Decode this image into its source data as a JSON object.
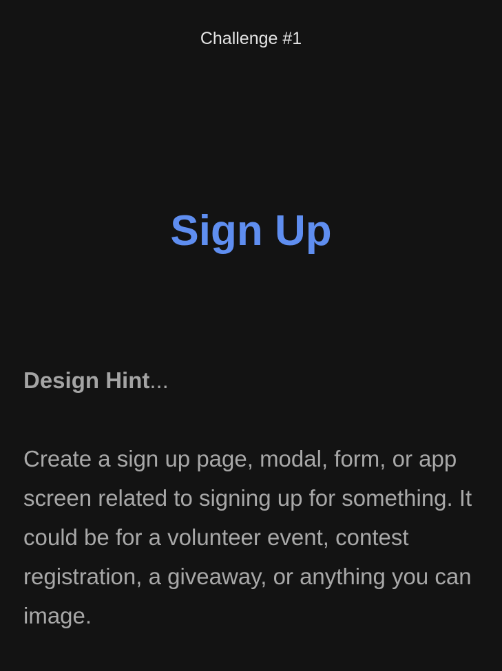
{
  "header": {
    "challenge_label": "Challenge #1"
  },
  "main": {
    "title": "Sign Up",
    "hint": {
      "heading_bold": "Design Hint",
      "heading_suffix": "...",
      "body": "Create a sign up page, modal, form, or app screen related to signing up for something. It could be for a volunteer event, contest registration, a giveaway, or anything you can image."
    }
  },
  "colors": {
    "background": "#131313",
    "title_accent": "#5f8ef0",
    "body_text": "#a8a8a8",
    "label_text": "#e4e4e4"
  }
}
